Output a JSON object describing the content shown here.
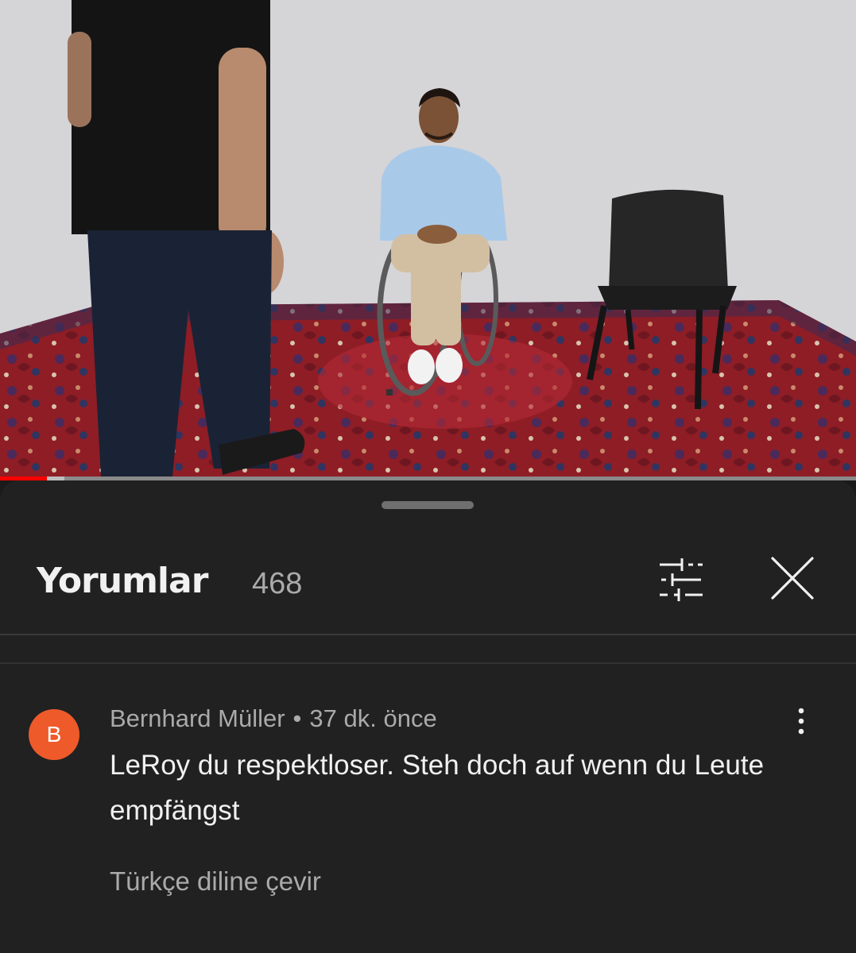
{
  "video": {
    "progress_fraction": 0.055,
    "buffered_fraction": 0.075,
    "colors": {
      "played": "#ff0000",
      "buffered": "#bdbdbd",
      "track": "#8a8a8a"
    }
  },
  "comments_panel": {
    "title": "Yorumlar",
    "count": "468",
    "filter_icon": "sliders-icon",
    "close_icon": "close-icon"
  },
  "comments": [
    {
      "avatar_letter": "B",
      "avatar_color": "#ef5a2b",
      "author": "Bernhard Müller",
      "separator": "•",
      "time": "37 dk. önce",
      "text": "LeRoy du respektloser. Steh doch auf wenn du Leute empfängst",
      "translate_label": "Türkçe diline çevir",
      "menu_icon": "more-vertical-icon"
    }
  ]
}
